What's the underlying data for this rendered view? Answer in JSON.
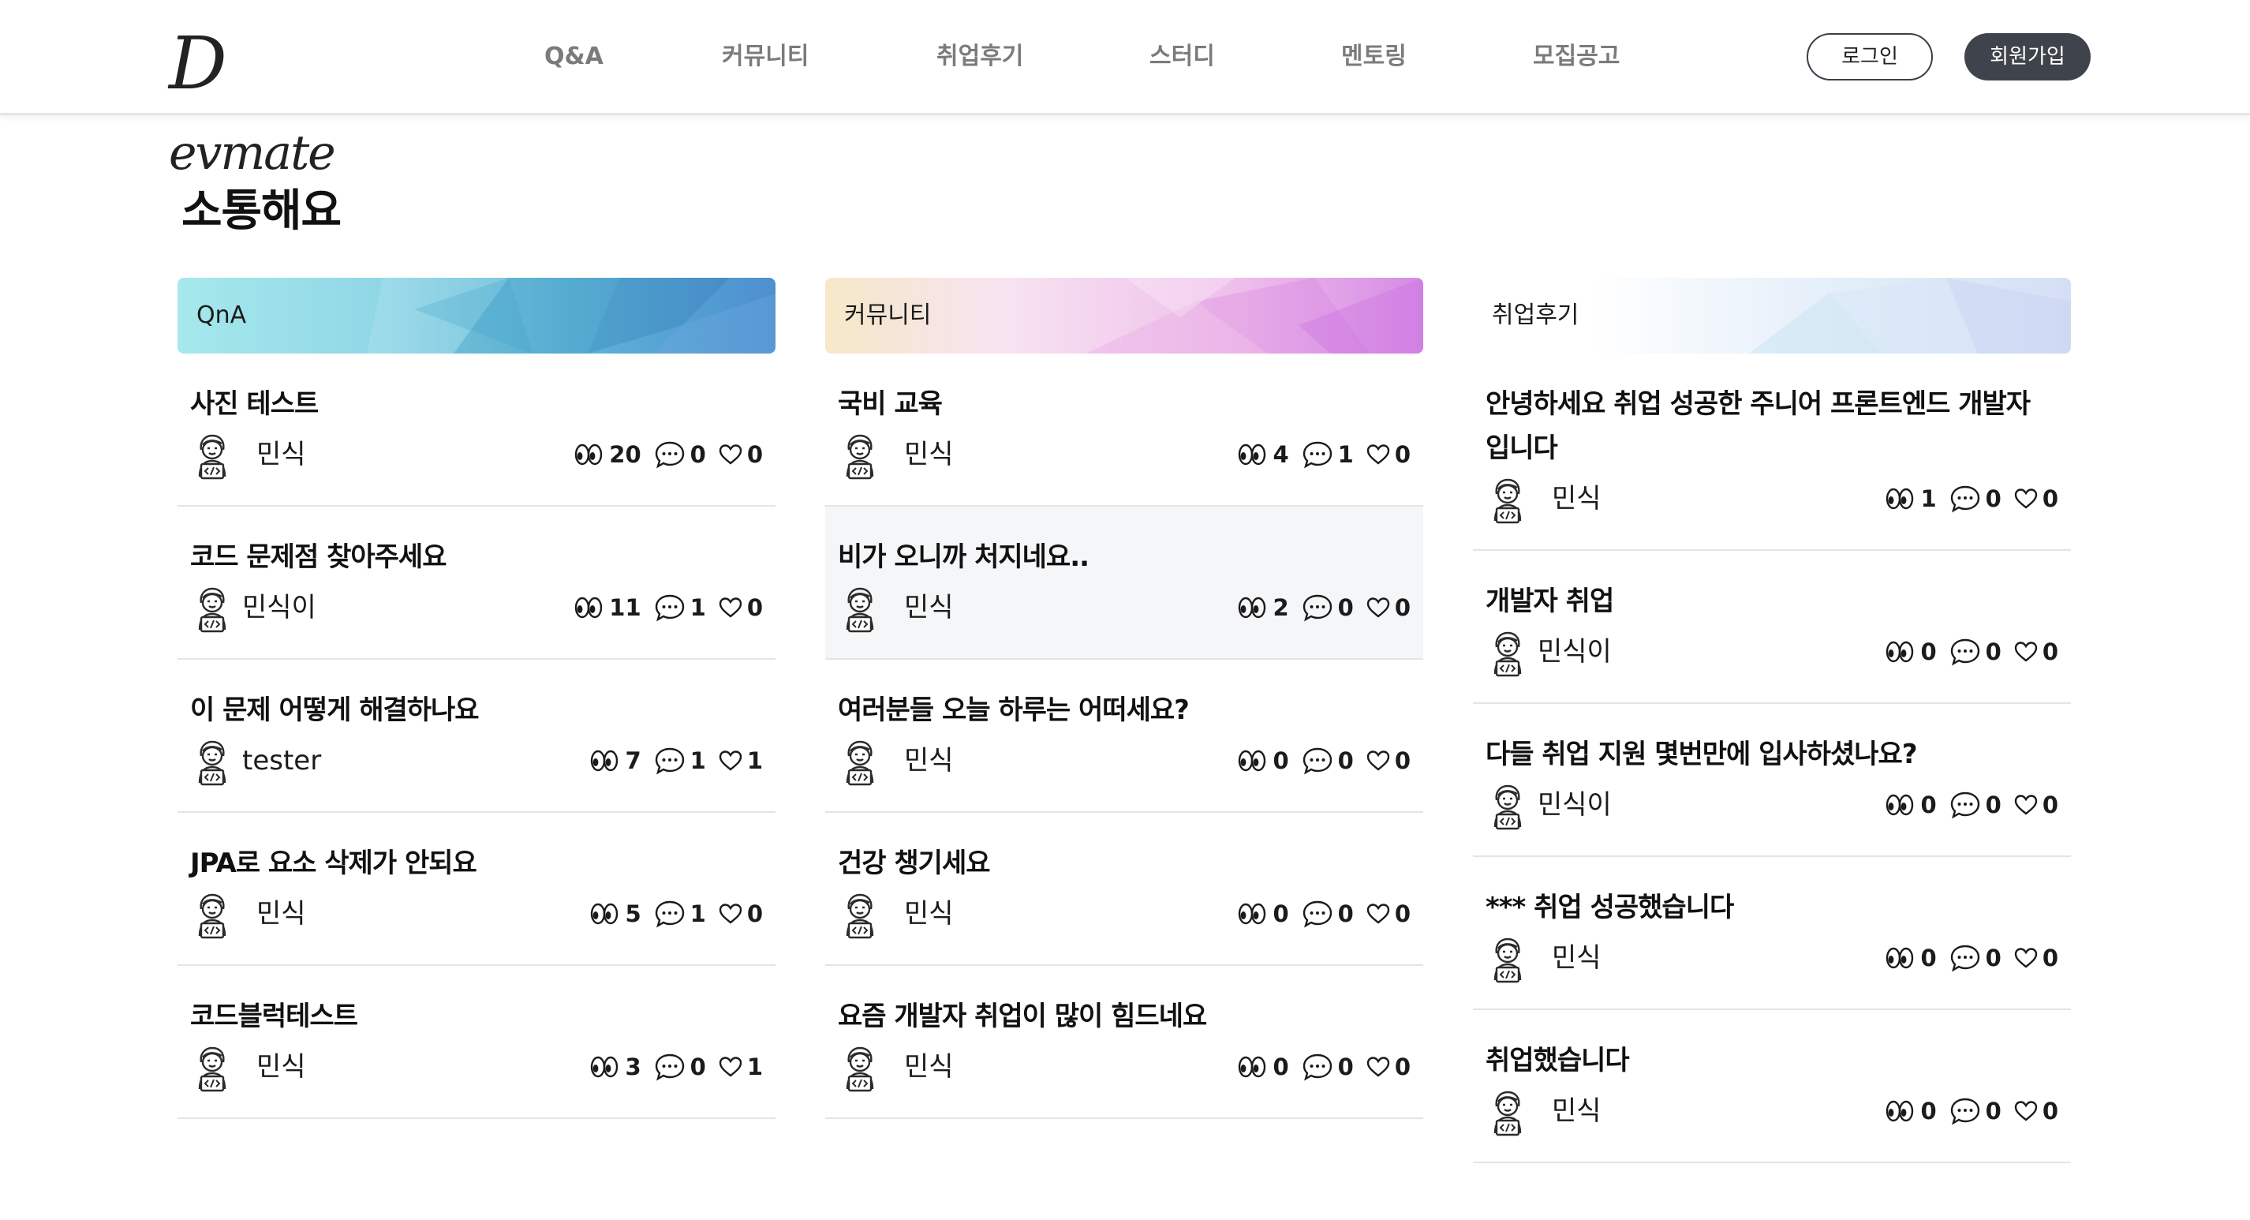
{
  "header": {
    "logo": "Devmate",
    "nav": [
      "Q&A",
      "커뮤니티",
      "취업후기",
      "스터디",
      "멘토링",
      "모집공고"
    ],
    "login_label": "로그인",
    "signup_label": "회원가입"
  },
  "page": {
    "title": "소통해요"
  },
  "columns": [
    {
      "title": "QnA",
      "posts": [
        {
          "title": "사진 테스트",
          "author": "민식",
          "views": "20",
          "comments": "0",
          "likes": "0"
        },
        {
          "title": "코드 문제점 찾아주세요",
          "author": "민식이",
          "views": "11",
          "comments": "1",
          "likes": "0"
        },
        {
          "title": "이 문제 어떻게 해결하나요",
          "author": "tester",
          "views": "7",
          "comments": "1",
          "likes": "1"
        },
        {
          "title": "JPA로 요소 삭제가 안되요",
          "author": "민식",
          "views": "5",
          "comments": "1",
          "likes": "0"
        },
        {
          "title": "코드블럭테스트",
          "author": "민식",
          "views": "3",
          "comments": "0",
          "likes": "1"
        }
      ]
    },
    {
      "title": "커뮤니티",
      "posts": [
        {
          "title": "국비 교육",
          "author": "민식",
          "views": "4",
          "comments": "1",
          "likes": "0"
        },
        {
          "title": "비가 오니까 처지네요..",
          "author": "민식",
          "views": "2",
          "comments": "0",
          "likes": "0"
        },
        {
          "title": "여러분들 오늘 하루는 어떠세요?",
          "author": "민식",
          "views": "0",
          "comments": "0",
          "likes": "0"
        },
        {
          "title": "건강 챙기세요",
          "author": "민식",
          "views": "0",
          "comments": "0",
          "likes": "0"
        },
        {
          "title": "요즘 개발자 취업이 많이 힘드네요",
          "author": "민식",
          "views": "0",
          "comments": "0",
          "likes": "0"
        }
      ]
    },
    {
      "title": "취업후기",
      "posts": [
        {
          "title": "안녕하세요 취업 성공한 주니어 프론트엔드 개발자입니다",
          "author": "민식",
          "views": "1",
          "comments": "0",
          "likes": "0"
        },
        {
          "title": "개발자 취업",
          "author": "민식이",
          "views": "0",
          "comments": "0",
          "likes": "0"
        },
        {
          "title": "다들 취업 지원 몇번만에 입사하셨나요?",
          "author": "민식이",
          "views": "0",
          "comments": "0",
          "likes": "0"
        },
        {
          "title": "*** 취업 성공했습니다",
          "author": "민식",
          "views": "0",
          "comments": "0",
          "likes": "0"
        },
        {
          "title": "취업했습니다",
          "author": "민식",
          "views": "0",
          "comments": "0",
          "likes": "0"
        }
      ]
    }
  ],
  "icons": {
    "views": "eyes-icon",
    "comments": "speech-bubble-icon",
    "likes": "heart-icon",
    "avatar": "developer-avatar-icon"
  }
}
